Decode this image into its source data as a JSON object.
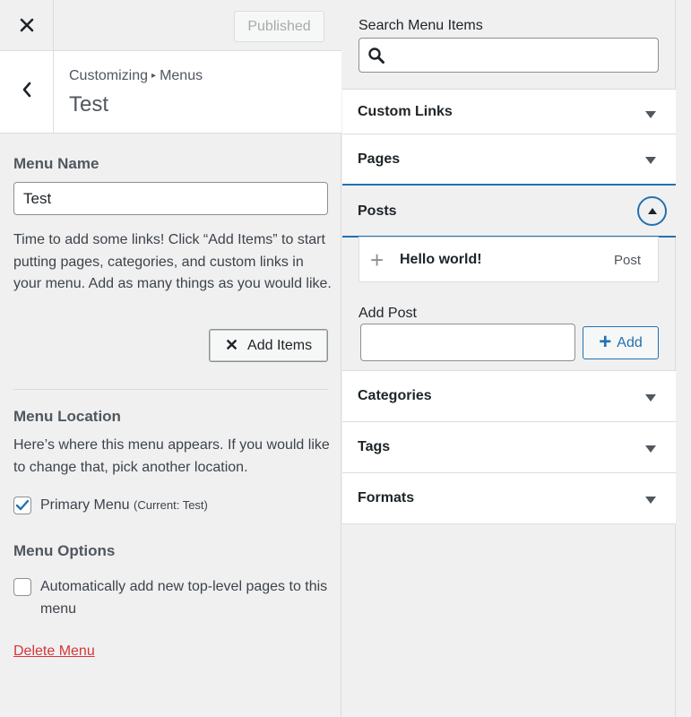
{
  "header": {
    "close_icon": "close-icon",
    "published_label": "Published"
  },
  "section": {
    "breadcrumb_parent": "Customizing",
    "breadcrumb_separator": "▸",
    "breadcrumb_current": "Menus",
    "title": "Test"
  },
  "menu_name": {
    "label": "Menu Name",
    "value": "Test",
    "help": "Time to add some links! Click “Add Items” to start putting pages, categories, and custom links in your menu. Add as many things as you would like.",
    "add_items_label": "Add Items",
    "add_items_icon": "✕"
  },
  "menu_location": {
    "label": "Menu Location",
    "help": "Here’s where this menu appears. If you would like to change that, pick another location.",
    "primary_label": "Primary Menu",
    "primary_current": "(Current: Test)",
    "primary_checked": true
  },
  "menu_options": {
    "label": "Menu Options",
    "auto_add_label": "Automatically add new top-level pages to this menu",
    "auto_add_checked": false
  },
  "delete_label": "Delete Menu",
  "available": {
    "search_label": "Search Menu Items",
    "search_value": "",
    "sections": {
      "custom_links": "Custom Links",
      "pages": "Pages",
      "posts": "Posts",
      "categories": "Categories",
      "tags": "Tags",
      "formats": "Formats"
    },
    "posts_item": {
      "title": "Hello world!",
      "type": "Post"
    },
    "add_post_label": "Add Post",
    "add_post_value": "",
    "add_button_label": "Add"
  },
  "colors": {
    "accent": "#2271b1",
    "danger": "#d63638",
    "panel_bg": "#f0f0f1"
  }
}
